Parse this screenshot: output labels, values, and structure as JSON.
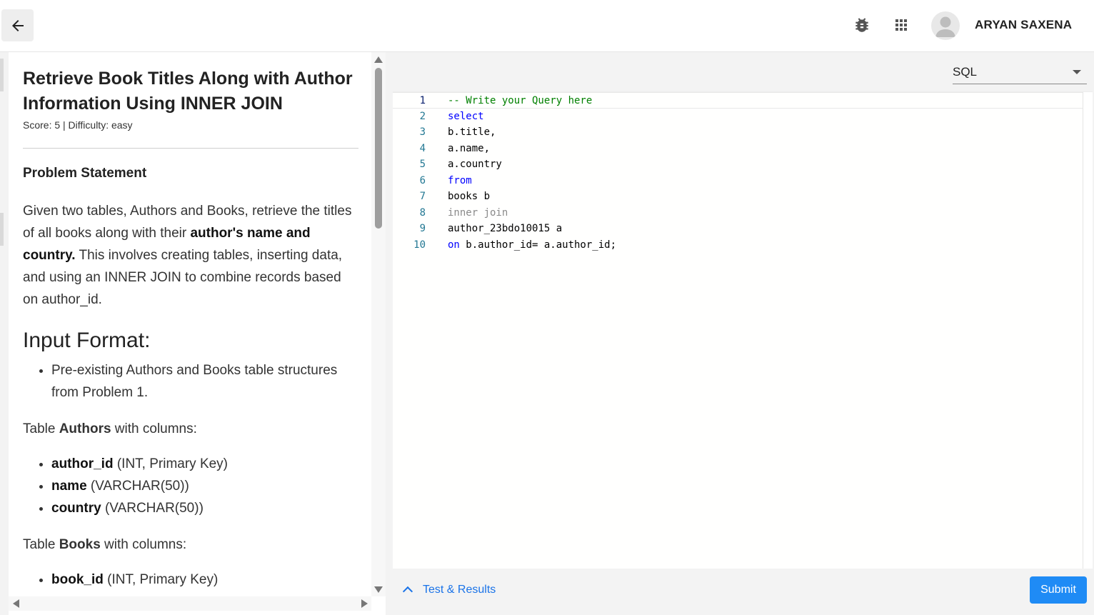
{
  "header": {
    "back_icon": "arrow-left-icon",
    "bug_icon": "bug-icon",
    "apps_icon": "apps-grid-icon",
    "avatar_icon": "person-avatar-icon",
    "user_name": "ARYAN SAXENA"
  },
  "question": {
    "title": "Retrieve Book Titles Along with Author Information Using INNER JOIN",
    "meta": "Score: 5 | Difficulty: easy",
    "problem_statement_heading": "Problem Statement",
    "statement_part1": "Given two tables, Authors and Books, retrieve the titles of all books along with their ",
    "statement_bold": "author's name and country.",
    "statement_part2": " This involves creating tables, inserting data, and using an INNER JOIN to combine records based on author_id.",
    "input_format_heading": "Input Format:",
    "input_bullets": [
      "Pre-existing Authors and Books table structures from Problem 1."
    ],
    "authors_line": {
      "prefix": "Table ",
      "bold": "Authors",
      "suffix": " with columns:"
    },
    "authors_columns": [
      {
        "name": "author_id",
        "type": " (INT, Primary Key)"
      },
      {
        "name": "name",
        "type": " (VARCHAR(50))"
      },
      {
        "name": "country",
        "type": " (VARCHAR(50))"
      }
    ],
    "books_line": {
      "prefix": "Table ",
      "bold": "Books",
      "suffix": " with columns:"
    },
    "books_columns": [
      {
        "name": "book_id",
        "type": " (INT, Primary Key)"
      }
    ]
  },
  "editor": {
    "language": "SQL",
    "lines": [
      {
        "num": "1",
        "text": "-- Write your Query here",
        "kind": "comment"
      },
      {
        "num": "2",
        "text": "select",
        "kind": "keyword"
      },
      {
        "num": "3",
        "text": "b.title,",
        "kind": "plain"
      },
      {
        "num": "4",
        "text": "a.name,",
        "kind": "plain"
      },
      {
        "num": "5",
        "text": "a.country",
        "kind": "plain"
      },
      {
        "num": "6",
        "text": "from",
        "kind": "keyword"
      },
      {
        "num": "7",
        "text": "books b",
        "kind": "plain"
      },
      {
        "num": "8",
        "text": "inner join",
        "kind": "muted"
      },
      {
        "num": "9",
        "text": "author_23bdo10015 a",
        "kind": "plain"
      },
      {
        "num": "10",
        "kw": "on",
        "text": " b.author_id= a.author_id;",
        "kind": "mixed"
      }
    ]
  },
  "footer": {
    "results_label": "Test & Results",
    "submit_label": "Submit",
    "accent_color": "#1a73e8"
  }
}
